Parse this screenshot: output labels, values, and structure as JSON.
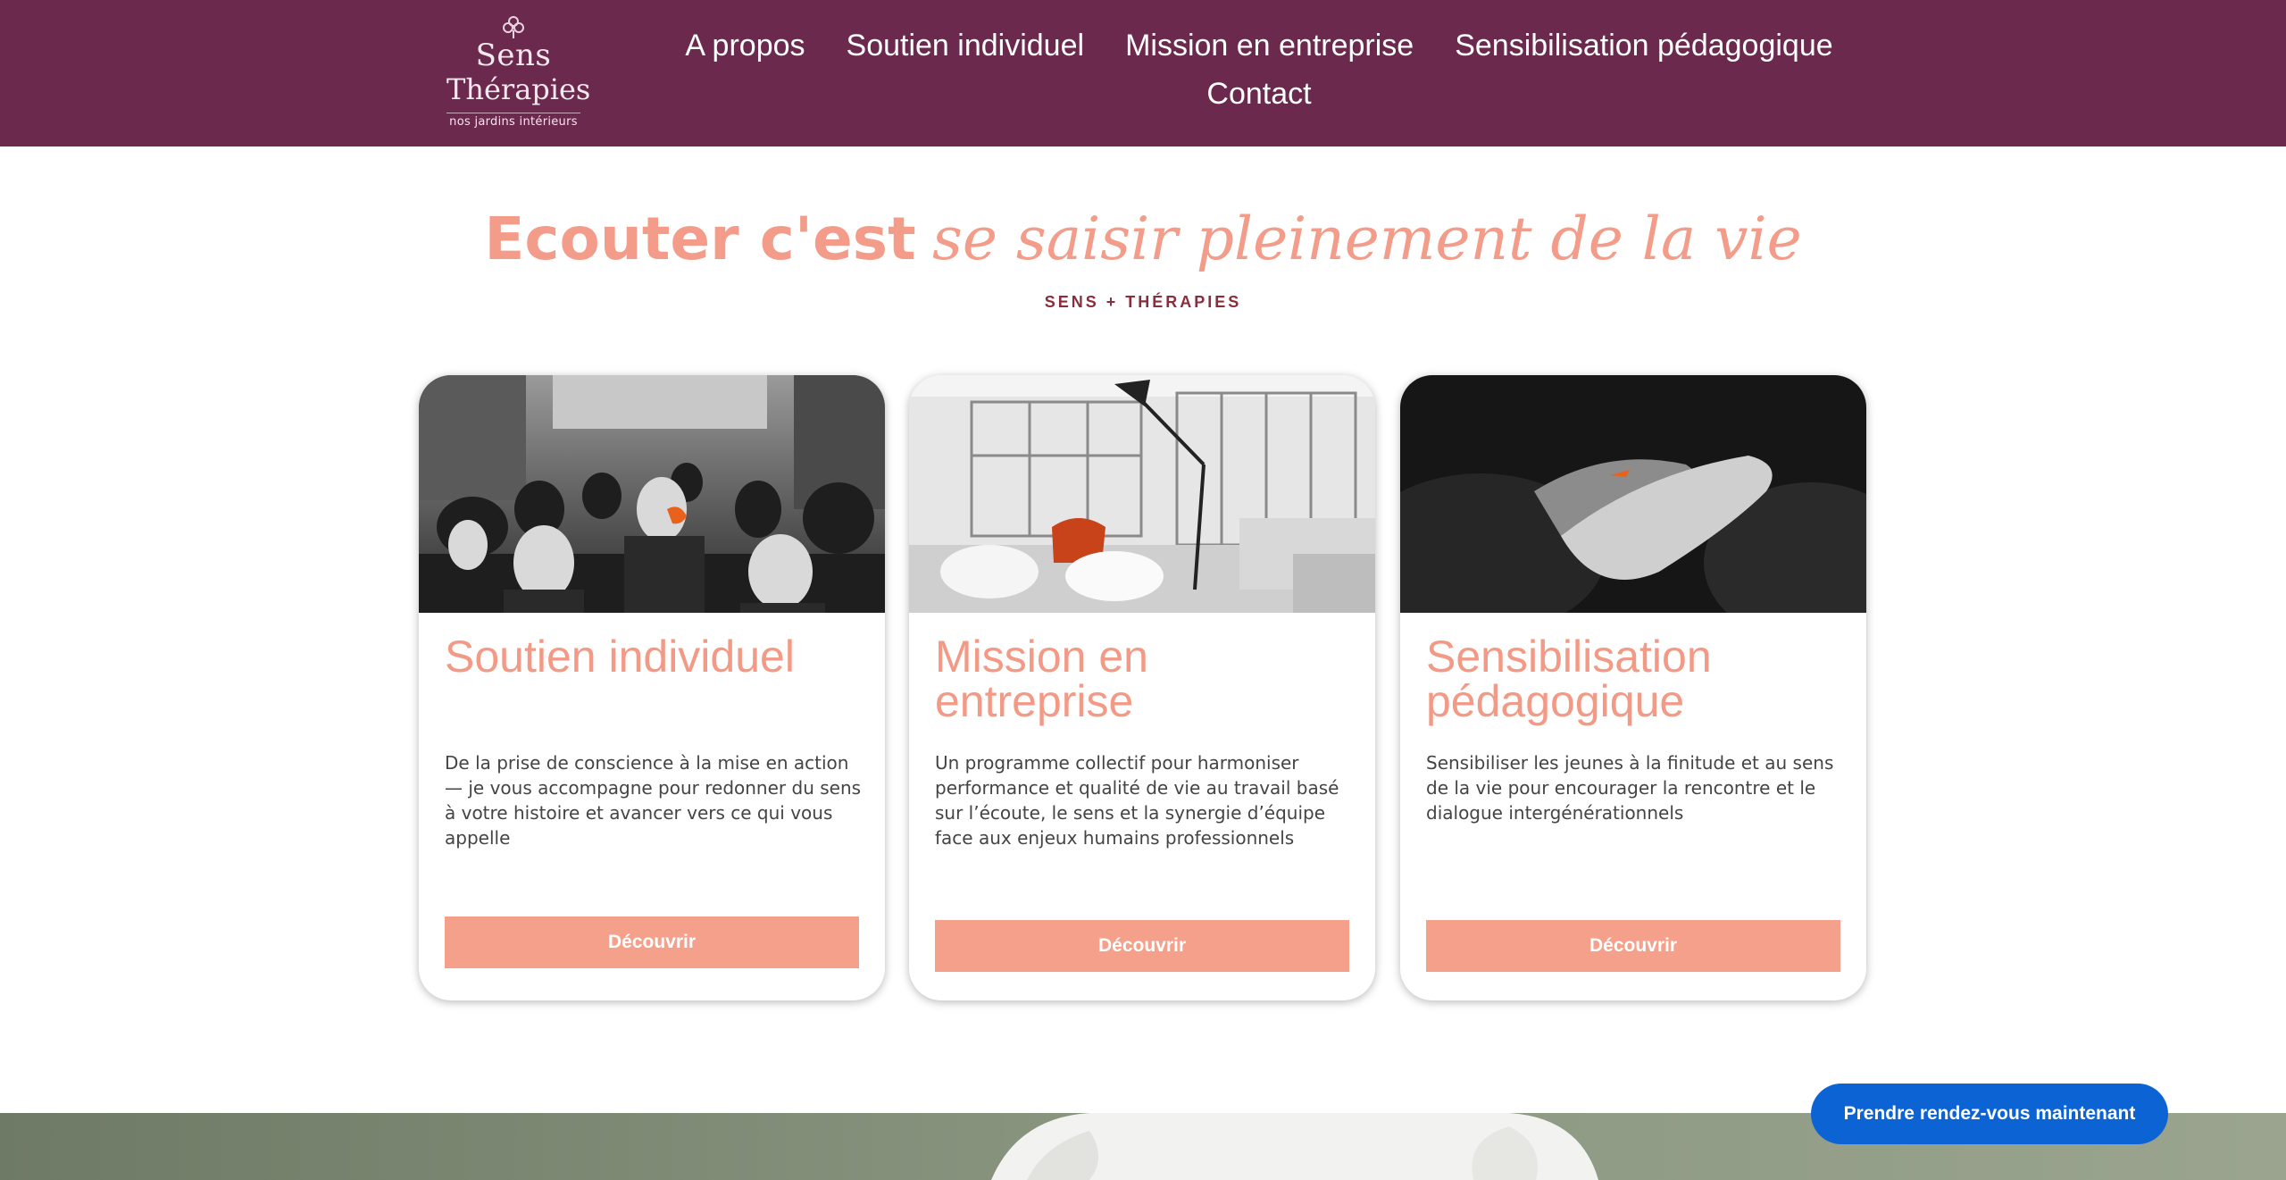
{
  "brand": {
    "line1": "Sens",
    "line2": "Thérapies",
    "tagline": "nos jardins intérieurs"
  },
  "nav": {
    "row1": [
      "A propos",
      "Soutien individuel",
      "Mission en entreprise",
      "Sensibilisation pédagogique"
    ],
    "row2": [
      "Contact"
    ]
  },
  "hero": {
    "title_bold": "Ecouter c'est",
    "title_italic": "se saisir pleinement de la vie",
    "subtitle": "SENS + THÉRAPIES"
  },
  "cards": [
    {
      "title": "Soutien individuel",
      "text": "De la prise de conscience à la mise en action — je vous accompagne pour redonner du sens à votre histoire et avancer vers ce qui vous appelle",
      "button": "Découvrir"
    },
    {
      "title": "Mission en entreprise",
      "text": "Un programme collectif pour harmoniser performance et qualité de vie au travail basé sur l’écoute, le sens et la synergie d’équipe face aux enjeux humains professionnels",
      "button": "Découvrir"
    },
    {
      "title": "Sensibilisation pédagogique",
      "text": "Sensibiliser les jeunes à la finitude et au sens de la vie pour encourager la rencontre et le dialogue intergénérationnels",
      "button": "Découvrir"
    }
  ],
  "cta": {
    "label": "Prendre rendez-vous maintenant"
  },
  "colors": {
    "header_bg": "#6b2a4d",
    "accent_salmon": "#f39c8a",
    "subtitle": "#8a2d3d",
    "cta_blue": "#0c63d4"
  }
}
